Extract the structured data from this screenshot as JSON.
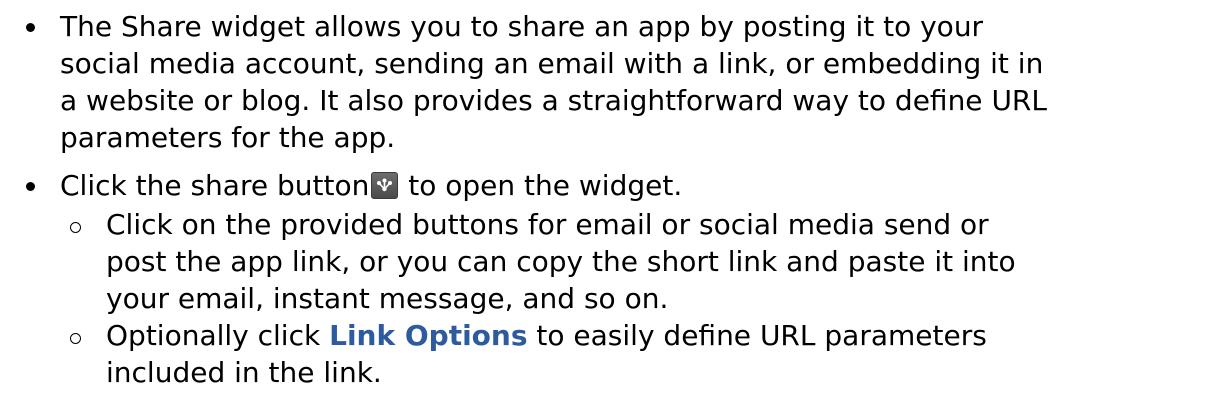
{
  "items": [
    {
      "lines": [
        "The Share widget allows you to share an app by posting it to your",
        "social media account, sending an email with a link, or embedding it in",
        "a website or blog. It also provides a straightforward way to define URL",
        "parameters for the app."
      ]
    },
    {
      "before_icon": "Click the share button",
      "icon": "share-icon",
      "after_icon": " to open the widget.",
      "subitems": [
        {
          "lines": [
            "Click on the provided buttons for email or social media send or",
            "post the app link, or you can copy the short link and paste it into",
            "your email, instant message, and so on."
          ]
        },
        {
          "prefix": "Optionally click ",
          "link_text": "Link Options",
          "suffix": " to easily define URL parameters",
          "line2": "included in the link."
        }
      ]
    }
  ],
  "colors": {
    "link": "#2e5aa0",
    "icon_background": "#5a5a5a"
  }
}
